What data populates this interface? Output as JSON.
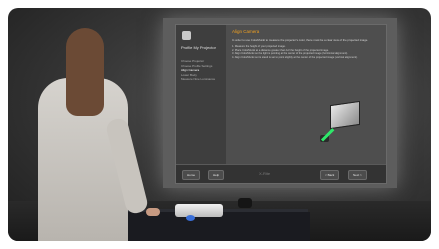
{
  "window": {
    "sidebar_title": "Profile My Projector",
    "sidebar_items": [
      {
        "label": "Choose Projector",
        "active": false
      },
      {
        "label": "Choose Profile Settings",
        "active": false
      },
      {
        "label": "Align Camera",
        "active": true
      },
      {
        "label": "Lower Body",
        "active": false
      },
      {
        "label": "Measure Nine Luminance",
        "active": false
      }
    ],
    "content_title": "Align Camera",
    "intro": "In order to use ColorMunki to measure the projector's color, there must be a clear view of the projected image.",
    "steps": [
      "1. Measure the height of your projected image.",
      "2. Place ColorMunki at a distance greater than 1/2 the height of the projected image.",
      "3. Align ColorMunki so the light is pointing at the center of the projected image (horizontal alignment).",
      "4. Align ColorMunki so its stand is set to point slightly at the center of the projected image (vertical alignment)."
    ],
    "footer": {
      "home_label": "Home",
      "help_label": "Help",
      "brand": "X-Rite",
      "back_label": "< Back",
      "next_label": "Next >"
    }
  },
  "colors": {
    "accent": "#f0a020",
    "beam": "#2ee86a"
  }
}
